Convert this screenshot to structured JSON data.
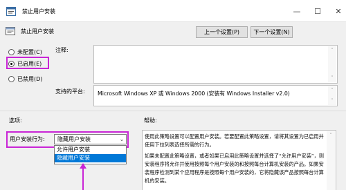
{
  "window": {
    "title": "禁止用户安装",
    "controls": {
      "minimize": "—",
      "maximize": "☐",
      "close": "✕"
    }
  },
  "header": {
    "policy_name": "禁止用户安装",
    "prev_button": "上一个设置(P)",
    "next_button": "下一个设置(N)"
  },
  "state": {
    "options": [
      {
        "label": "未配置(C)",
        "selected": false
      },
      {
        "label": "已启用(E)",
        "selected": true
      },
      {
        "label": "已禁用(D)",
        "selected": false
      }
    ],
    "comment_label": "注释:",
    "comment_value": "",
    "supported_label": "支持的平台:",
    "supported_value": "Microsoft Windows XP 或 Windows 2000 (安装有 Windows Installer v2.0)"
  },
  "options_section": {
    "title": "选项:",
    "dropdown_label": "用户安装行为:",
    "dropdown_value": "隐藏用户安装",
    "dropdown_items": [
      {
        "label": "允许用户安装",
        "selected": false
      },
      {
        "label": "隐藏用户安装",
        "selected": true
      }
    ]
  },
  "help_section": {
    "title": "帮助:",
    "paragraphs": [
      "使用此策略设置可以配置用户安装。若要配置此策略设置，请将其设置为已启用并使用下拉列表选择所需的行为。",
      "如果未配置此策略设置，或者如果已启用此策略设置并选择了“允许用户安装”，则安装程序将允许并使用按照每个用户安装的和按照每台计算机安装的产品。如果安装程序检测到某个应用程序是按照每个用户安装的，它将隐藏该产品按照每台计算机的安装。"
    ]
  },
  "annotation_color": "#c925d6"
}
